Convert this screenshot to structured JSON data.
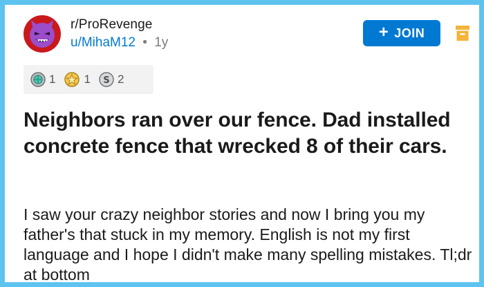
{
  "post": {
    "subreddit": "r/ProRevenge",
    "author": "u/MihaM12",
    "separator": "•",
    "age": "1y",
    "join_label": "JOIN",
    "title": "Neighbors ran over our fence. Dad installed concrete fence that wrecked 8 of their cars.",
    "body": "I saw your crazy neighbor stories and now I bring you my father's that stuck in my memory. English is not my first language and I hope I didn't make many spelling mistakes. Tl;dr at bottom"
  },
  "awards": [
    {
      "icon": "globe-award-icon",
      "count": "1"
    },
    {
      "icon": "star-award-icon",
      "count": "1"
    },
    {
      "icon": "silver-award-icon",
      "count": "2"
    }
  ],
  "icons": {
    "avatar": "devil-snoo-icon",
    "join_plus": "plus-icon",
    "archive": "archive-icon"
  },
  "colors": {
    "frame_border": "#5fc3f0",
    "join_button": "#0079d3",
    "avatar_ring": "#c9191c",
    "avatar_face": "#9b4dca",
    "archive": "#f4b43a",
    "author_link": "#0079d3"
  }
}
